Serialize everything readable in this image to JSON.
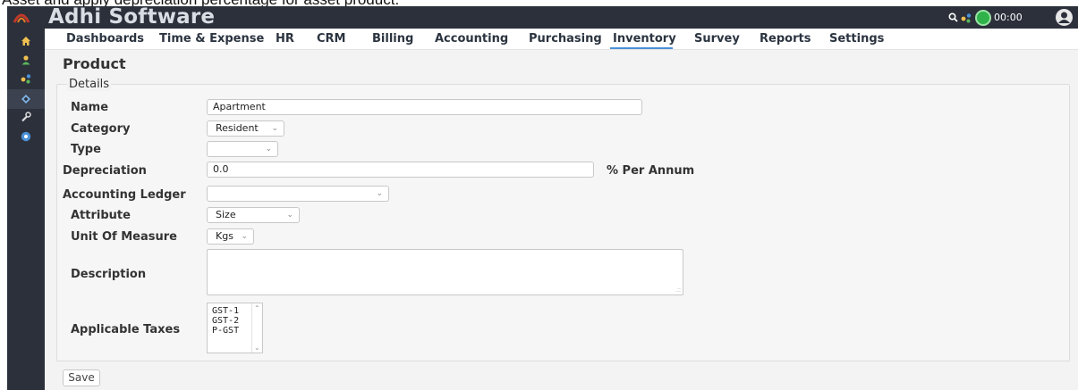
{
  "caption": "Asset and apply depreciation percentage for asset product.",
  "app": {
    "brand": "Adhi Software"
  },
  "topbar": {
    "icons": [
      "search-icon",
      "share-icon"
    ],
    "timer": "00:00",
    "colors": {
      "bar": "#2b303b",
      "timer": "#2fb24a"
    }
  },
  "sidebar": {
    "icons": [
      "home-icon",
      "user-icon",
      "share-icon",
      "diamond-icon",
      "wrench-icon",
      "help-icon"
    ]
  },
  "menu": {
    "items": [
      "Dashboards",
      "Time & Expense",
      "HR",
      "CRM",
      "Billing",
      "Accounting",
      "Purchasing",
      "Inventory",
      "Survey",
      "Reports",
      "Settings"
    ],
    "active": "Inventory"
  },
  "page": {
    "title": "Product",
    "legend": "Details"
  },
  "form": {
    "name": {
      "label": "Name",
      "value": "Apartment"
    },
    "category": {
      "label": "Category",
      "value": "Resident"
    },
    "type": {
      "label": "Type",
      "value": ""
    },
    "depreciation": {
      "label": "Depreciation",
      "value": "0.0",
      "suffix": "% Per Annum"
    },
    "ledger": {
      "label": "Accounting Ledger",
      "value": ""
    },
    "attribute": {
      "label": "Attribute",
      "value": "Size"
    },
    "uom": {
      "label": "Unit Of Measure",
      "value": "Kgs"
    },
    "description": {
      "label": "Description",
      "value": ""
    },
    "taxes": {
      "label": "Applicable Taxes",
      "options": [
        "GST-1",
        "GST-2",
        "P-GST"
      ]
    }
  },
  "actions": {
    "save": "Save"
  }
}
